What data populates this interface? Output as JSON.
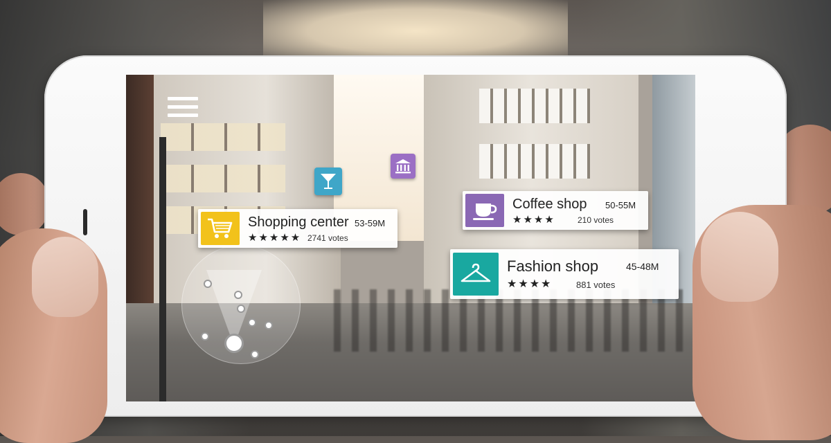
{
  "menu": {
    "icon": "hamburger-menu-icon"
  },
  "pins": [
    {
      "name": "cocktail-bar",
      "icon": "cocktail-glass-icon",
      "color": "#3fa6c8"
    },
    {
      "name": "bank",
      "icon": "bank-building-icon",
      "color": "#9b6fc4"
    }
  ],
  "cards": [
    {
      "id": "shopping-center",
      "name": "Shopping center",
      "distance": "53-59M",
      "stars": "★★★★★",
      "rating": 5,
      "votes": "2741 votes",
      "icon": "shopping-cart-icon",
      "color": "#f2c21b"
    },
    {
      "id": "coffee-shop",
      "name": "Coffee shop",
      "distance": "50-55M",
      "stars": "★★★★",
      "rating": 4,
      "votes": "210 votes",
      "icon": "coffee-cup-icon",
      "color": "#8a68b4"
    },
    {
      "id": "fashion-shop",
      "name": "Fashion  shop",
      "distance": "45-48M",
      "stars": "★★★★",
      "rating": 4,
      "votes": "881 votes",
      "icon": "clothes-hanger-icon",
      "color": "#19a8a0"
    }
  ],
  "radar": {
    "icon": "radar-compass-icon"
  }
}
